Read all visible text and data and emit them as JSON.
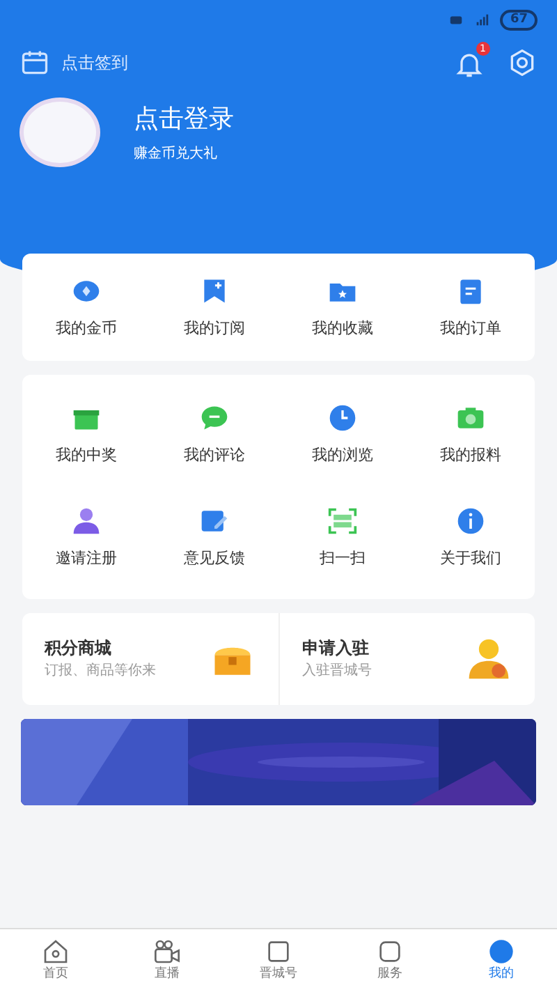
{
  "status_bar": {
    "battery": "67"
  },
  "header": {
    "checkin": "点击签到",
    "notification_badge": "1"
  },
  "profile": {
    "title": "点击登录",
    "subtitle": "赚金币兑大礼"
  },
  "menu_top": [
    {
      "label": "我的金币"
    },
    {
      "label": "我的订阅"
    },
    {
      "label": "我的收藏"
    },
    {
      "label": "我的订单"
    }
  ],
  "menu_grid": [
    {
      "label": "我的中奖"
    },
    {
      "label": "我的评论"
    },
    {
      "label": "我的浏览"
    },
    {
      "label": "我的报料"
    },
    {
      "label": "邀请注册"
    },
    {
      "label": "意见反馈"
    },
    {
      "label": "扫一扫"
    },
    {
      "label": "关于我们"
    }
  ],
  "shortcuts": [
    {
      "title": "积分商城",
      "subtitle": "订报、商品等你来"
    },
    {
      "title": "申请入驻",
      "subtitle": "入驻晋城号"
    }
  ],
  "tab_bar": [
    {
      "label": "首页",
      "selected": false
    },
    {
      "label": "直播",
      "selected": false
    },
    {
      "label": "晋城号",
      "selected": false
    },
    {
      "label": "服务",
      "selected": false
    },
    {
      "label": "我的",
      "selected": true
    }
  ]
}
